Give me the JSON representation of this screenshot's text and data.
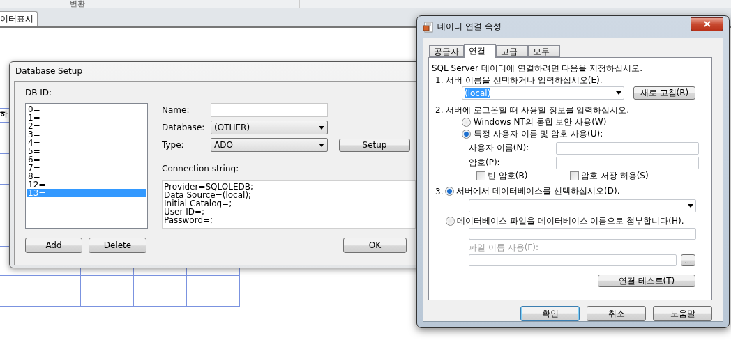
{
  "app": {
    "ribbon_label": "변환",
    "document_tab": "이터표시",
    "grid_fragment": "하"
  },
  "database_setup": {
    "title": "Database Setup",
    "db_id_label": "DB ID:",
    "db_ids": [
      {
        "label": "0=",
        "selected": false
      },
      {
        "label": "1=",
        "selected": false
      },
      {
        "label": "2=",
        "selected": false
      },
      {
        "label": "3=",
        "selected": false
      },
      {
        "label": "4=",
        "selected": false
      },
      {
        "label": "5=",
        "selected": false
      },
      {
        "label": "6=",
        "selected": false
      },
      {
        "label": "7=",
        "selected": false
      },
      {
        "label": "8=",
        "selected": false
      },
      {
        "label": "12=",
        "selected": false
      },
      {
        "label": "13=",
        "selected": true
      }
    ],
    "name_label": "Name:",
    "database_label": "Database:",
    "database_value": "(OTHER)",
    "type_label": "Type:",
    "type_value": "ADO",
    "setup_button": "Setup",
    "connection_label": "Connection string:",
    "connection_string": [
      "Provider=SQLOLEDB;",
      "Data Source=(local);",
      "Initial Catalog=;",
      "User ID=;",
      "Password=;"
    ],
    "add_button": "Add",
    "delete_button": "Delete",
    "ok_button": "OK"
  },
  "data_link": {
    "title": "데이터 연결 속성",
    "tabs": [
      {
        "label": "공급자",
        "selected": false
      },
      {
        "label": "연결",
        "selected": true
      },
      {
        "label": "고급",
        "selected": false
      },
      {
        "label": "모두",
        "selected": false
      }
    ],
    "intro": "SQL Server 데이터에 연결하려면 다음을 지정하십시오.",
    "step1": "1. 서버 이름을 선택하거나 입력하십시오(E).",
    "server_value": "(local)",
    "refresh_button": "새로 고침(R)",
    "step2": "2. 서버에 로그온할 때 사용할 정보를 입력하십시오.",
    "auth_options": [
      {
        "label": "Windows NT의 통합 보안 사용(W)",
        "selected": false
      },
      {
        "label": "특정 사용자 이름 및 암호 사용(U):",
        "selected": true
      }
    ],
    "username_label": "사용자 이름(N):",
    "password_label": "암호(P):",
    "checkboxes": [
      {
        "label": "빈 암호(B)",
        "checked": false
      },
      {
        "label": "암호 저장 허용(S)",
        "checked": false
      }
    ],
    "step3_number": "3.",
    "db_options": [
      {
        "label": "서버에서 데이터베이스를 선택하십시오(D).",
        "selected": true
      },
      {
        "label": "데이터베이스 파일을 데이터베이스 이름으로 첨부합니다(H).",
        "selected": false
      }
    ],
    "file_name_label": "파일 이름 사용(F):",
    "file_name_disabled": true,
    "browse_button": "...",
    "test_button": "연결 테스트(T)",
    "buttons": [
      {
        "label": "확인",
        "default": true
      },
      {
        "label": "취소",
        "default": false
      },
      {
        "label": "도움말",
        "default": false
      }
    ]
  }
}
